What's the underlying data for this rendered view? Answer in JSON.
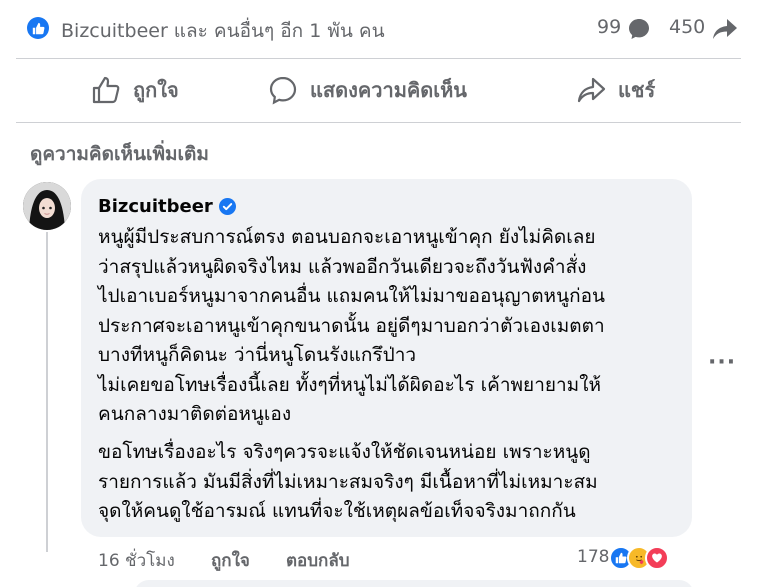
{
  "summary": {
    "reactors_text": "Bizcuitbeer และ คนอื่นๆ อีก 1 พัน คน",
    "comment_count": "99",
    "share_count": "450"
  },
  "actions": {
    "like_label": "ถูกใจ",
    "comment_label": "แสดงความคิดเห็น",
    "share_label": "แชร์"
  },
  "more_comments_label": "ดูความคิดเห็นเพิ่มเติม",
  "comment": {
    "author": "Bizcuitbeer",
    "paragraph1": [
      "หนูผู้มีประสบการณ์ตรง ตอนบอกจะเอาหนูเข้าคุก ยังไม่คิดเลย",
      "ว่าสรุปแล้วหนูผิดจริงไหม แล้วพออีกวันเดียวจะถึงวันฟังคำสั่ง",
      "ไปเอาเบอร์หนูมาจากคนอื่น แถมคนให้ไม่มาขออนุญาตหนูก่อน",
      "ประกาศจะเอาหนูเข้าคุกขนาดนั้น อยู่ดีๆมาบอกว่าตัวเองเมตตา",
      "บางทีหนูก็คิดนะ ว่านี่หนูโดนรังแกรึป่าว",
      "ไม่เคยขอโทษเรื่องนี้เลย ทั้งๆที่หนูไม่ได้ผิดอะไร เค้าพยายามให้",
      "คนกลางมาติดต่อหนูเอง"
    ],
    "paragraph2": [
      "ขอโทษเรื่องอะไร จริงๆควรจะแจ้งให้ชัดเจนหน่อย เพราะหนูดู",
      "รายการแล้ว มันมีสิ่งที่ไม่เหมาะสมจริงๆ มีเนื้อหาที่ไม่เหมาะสม",
      "จุดให้คนดูใช้อารมณ์ แทนที่จะใช้เหตุผลข้อเท็จจริงมาถกกัน"
    ],
    "time": "16 ชั่วโมง",
    "like_label": "ถูกใจ",
    "reply_label": "ตอบกลับ",
    "reaction_count": "178"
  },
  "colors": {
    "accent": "#1877f2",
    "secondary_text": "#65676b",
    "bubble": "#f0f2f5"
  },
  "icons": [
    "like-icon",
    "comment-icon",
    "share-icon",
    "verified-icon",
    "more-options-icon",
    "care-icon",
    "love-icon"
  ]
}
